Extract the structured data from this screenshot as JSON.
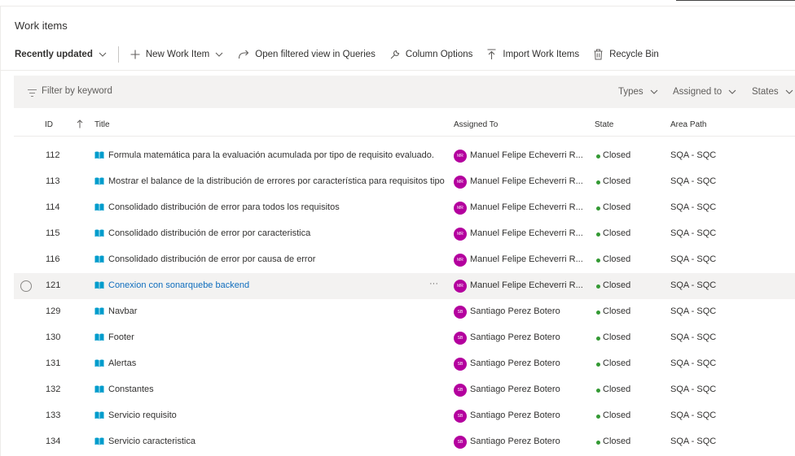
{
  "page_title": "Work items",
  "toolbar": {
    "view_label": "Recently updated",
    "new_item_label": "New Work Item",
    "open_queries_label": "Open filtered view in Queries",
    "column_options_label": "Column Options",
    "import_label": "Import Work Items",
    "recycle_label": "Recycle Bin"
  },
  "filter": {
    "placeholder": "Filter by keyword",
    "types_label": "Types",
    "assigned_label": "Assigned to",
    "states_label": "States"
  },
  "columns": {
    "id": "ID",
    "title": "Title",
    "assigned": "Assigned To",
    "state": "State",
    "area": "Area Path"
  },
  "colors": {
    "accent": "#106ebe",
    "avatar": "#b4009e",
    "closed_dot": "#339933",
    "story_icon": "#009ccc"
  },
  "rows": [
    {
      "id": "112",
      "title": "Formula matemática para la evaluación acumulada por tipo de requisito evaluado.",
      "avatar": "MR",
      "assigned": "Manuel Felipe Echeverri R...",
      "state": "Closed",
      "area": "SQA - SQC"
    },
    {
      "id": "113",
      "title": "Mostrar el balance de la distribución de errores por característica para requisitos tipo",
      "avatar": "MR",
      "assigned": "Manuel Felipe Echeverri R...",
      "state": "Closed",
      "area": "SQA - SQC"
    },
    {
      "id": "114",
      "title": "Consolidado distribución de error para todos los requisitos",
      "avatar": "MR",
      "assigned": "Manuel Felipe Echeverri R...",
      "state": "Closed",
      "area": "SQA - SQC"
    },
    {
      "id": "115",
      "title": "Consolidado distribución de error por caracteristica",
      "avatar": "MR",
      "assigned": "Manuel Felipe Echeverri R...",
      "state": "Closed",
      "area": "SQA - SQC"
    },
    {
      "id": "116",
      "title": "Consolidado distribución de error por causa de error",
      "avatar": "MR",
      "assigned": "Manuel Felipe Echeverri R...",
      "state": "Closed",
      "area": "SQA - SQC"
    },
    {
      "id": "121",
      "title": "Conexion con sonarquebe backend",
      "more": "···",
      "avatar": "MR",
      "assigned": "Manuel Felipe Echeverri R...",
      "state": "Closed",
      "area": "SQA - SQC"
    },
    {
      "id": "129",
      "title": "Navbar",
      "avatar": "SB",
      "assigned": "Santiago Perez Botero",
      "state": "Closed",
      "area": "SQA - SQC"
    },
    {
      "id": "130",
      "title": "Footer",
      "avatar": "SB",
      "assigned": "Santiago Perez Botero",
      "state": "Closed",
      "area": "SQA - SQC"
    },
    {
      "id": "131",
      "title": "Alertas",
      "avatar": "SB",
      "assigned": "Santiago Perez Botero",
      "state": "Closed",
      "area": "SQA - SQC"
    },
    {
      "id": "132",
      "title": "Constantes",
      "avatar": "SB",
      "assigned": "Santiago Perez Botero",
      "state": "Closed",
      "area": "SQA - SQC"
    },
    {
      "id": "133",
      "title": "Servicio requisito",
      "avatar": "SB",
      "assigned": "Santiago Perez Botero",
      "state": "Closed",
      "area": "SQA - SQC"
    },
    {
      "id": "134",
      "title": "Servicio caracteristica",
      "avatar": "SB",
      "assigned": "Santiago Perez Botero",
      "state": "Closed",
      "area": "SQA - SQC"
    }
  ]
}
